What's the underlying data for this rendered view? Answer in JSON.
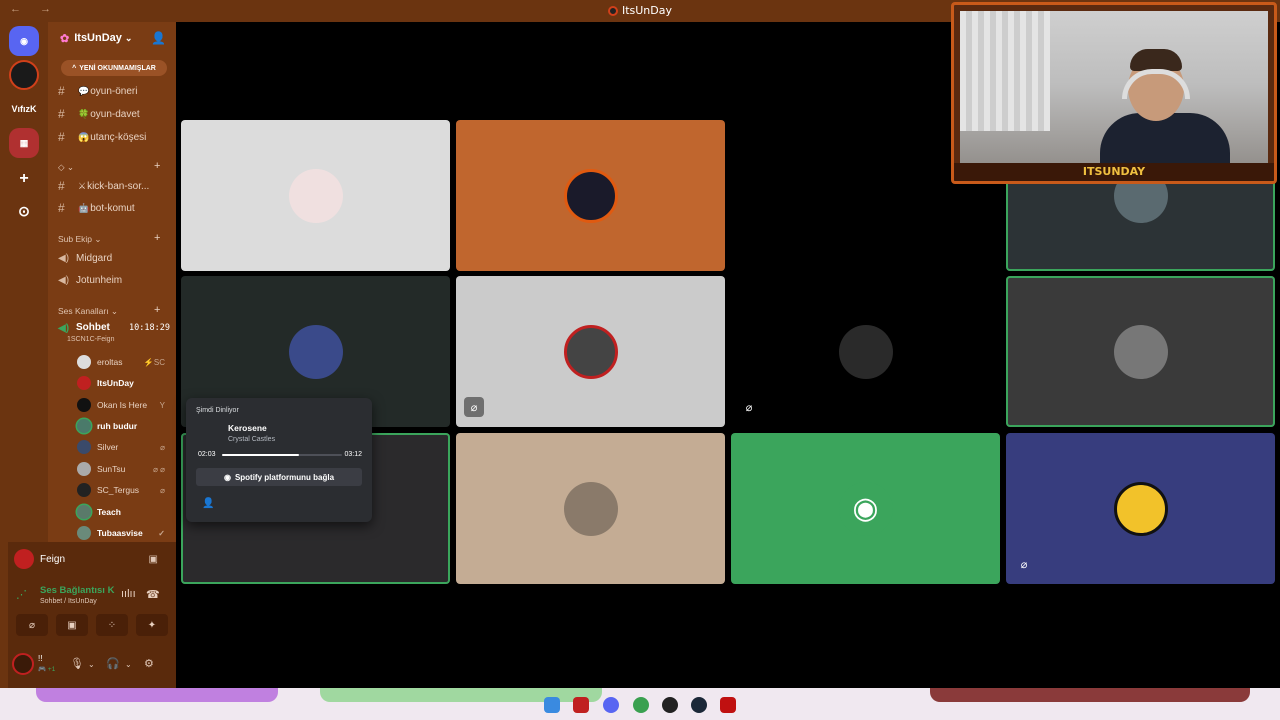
{
  "window": {
    "title": "ItsUnDay"
  },
  "server": {
    "name": "ItsUnDay",
    "unread_label": "YENİ OKUNMAMIŞLAR",
    "rail": [
      {
        "label": "",
        "color": "#5865f2",
        "icon": "discord-home-icon"
      },
      {
        "label": "",
        "color": "#1a1a1a",
        "icon": "itsunday-server-icon"
      },
      {
        "label": "VıfızK",
        "color": "#6b3410",
        "icon": "vifizk-server-icon"
      },
      {
        "label": "",
        "color": "#b03030",
        "icon": "server-folder-icon"
      },
      {
        "label": "+",
        "color": "#6b3410",
        "icon": "add-server-icon"
      },
      {
        "label": "⊙",
        "color": "#6b3410",
        "icon": "discover-icon"
      }
    ]
  },
  "channels": {
    "text": [
      {
        "emoji": "💬",
        "name": "oyun-öneri"
      },
      {
        "emoji": "🍀",
        "name": "oyun-davet"
      },
      {
        "emoji": "😱",
        "name": "utanç-köşesi"
      }
    ],
    "cat2_label": "◇ ⌄",
    "text2": [
      {
        "emoji": "⚔",
        "name": "kick-ban-sor..."
      },
      {
        "emoji": "🤖",
        "name": "bot-komut"
      }
    ],
    "sub_ekip_label": "Sub Ekip ⌄",
    "sub_ekip": [
      "Midgard",
      "Jotunheim"
    ],
    "ses_label": "Ses Kanalları ⌄",
    "active_voice": {
      "name": "Sohbet",
      "time": "10:18:29",
      "sub": "1SCN1C-Feign"
    },
    "voice_users": [
      {
        "name": "eroltas",
        "color": "#ddd",
        "icons": "⚡SC"
      },
      {
        "name": "ItsUnDay",
        "color": "#c02020",
        "icons": ""
      },
      {
        "name": "Okan Is Here",
        "color": "#111",
        "icons": "Y"
      },
      {
        "name": "ruh budur",
        "color": "#4a7a6a",
        "icons": ""
      },
      {
        "name": "Silver",
        "color": "#3a4a6a",
        "icons": "⌀"
      },
      {
        "name": "SunTsu",
        "color": "#aaa",
        "icons": "⌀ ⌀"
      },
      {
        "name": "SC_Tergus",
        "color": "#222",
        "icons": "⌀"
      },
      {
        "name": "Teach",
        "color": "#5a7a6a",
        "icons": ""
      },
      {
        "name": "Tubaasvise",
        "color": "#6a8a7a",
        "icons": "✓"
      }
    ]
  },
  "panel": {
    "live_name": "Feign",
    "conn_title": "Ses Bağlantısı K",
    "conn_sub": "Sohbet / ItsUnDay",
    "me_name": "!!",
    "me_status": "🎮 +1"
  },
  "tiles": [
    {
      "bg": "#dcdcdc",
      "av": "#f0e0e0",
      "speaking": false,
      "icon": "",
      "icon_name": ""
    },
    {
      "bg": "#c0662e",
      "av": "#1a1a2a",
      "speaking": false,
      "icon": "",
      "icon_name": ""
    },
    {
      "bg": "#000000",
      "av": "#000000",
      "speaking": false,
      "icon": "",
      "icon_name": ""
    },
    {
      "bg": "#2c3336",
      "av": "#5a6a70",
      "speaking": true,
      "icon": "",
      "icon_name": ""
    },
    {
      "bg": "#232a28",
      "av": "#3a4a8a",
      "speaking": false,
      "icon": "",
      "icon_name": ""
    },
    {
      "bg": "#cbcbcb",
      "av": "#444444",
      "speaking": false,
      "icon": "⌀",
      "icon_name": "camera-off-icon"
    },
    {
      "bg": "#000000",
      "av": "#2a2a2a",
      "speaking": false,
      "icon": "⌀",
      "icon_name": "mute-icon"
    },
    {
      "bg": "#3a3a3a",
      "av": "#777777",
      "speaking": true,
      "icon": "",
      "icon_name": ""
    },
    {
      "bg": "#2b2a2c",
      "av": "#c080c0",
      "speaking": true,
      "icon": "",
      "icon_name": ""
    },
    {
      "bg": "#c4ac94",
      "av": "#8a7a6a",
      "speaking": false,
      "icon": "",
      "icon_name": ""
    },
    {
      "bg": "#3ba55c",
      "av": "#3ba55c",
      "speaking": false,
      "icon": "",
      "icon_name": ""
    },
    {
      "bg": "#373d7e",
      "av": "#f2c22a",
      "speaking": false,
      "icon": "⌀",
      "icon_name": "mute-icon"
    }
  ],
  "webcam": {
    "label": "ITSUNDAY"
  },
  "spotify": {
    "header": "Şimdi Dinliyor",
    "song": "Kerosene",
    "artist": "Crystal Castles",
    "time_start": "02:03",
    "time_end": "03:12",
    "progress": 0.64,
    "connect_label": "Spotify platformunu bağla"
  },
  "taskbar": {
    "apps": [
      "windows-start-icon",
      "video-app-icon",
      "discord-app-icon",
      "chrome-icon",
      "obs-icon",
      "steam-icon",
      "red-app-icon"
    ]
  }
}
